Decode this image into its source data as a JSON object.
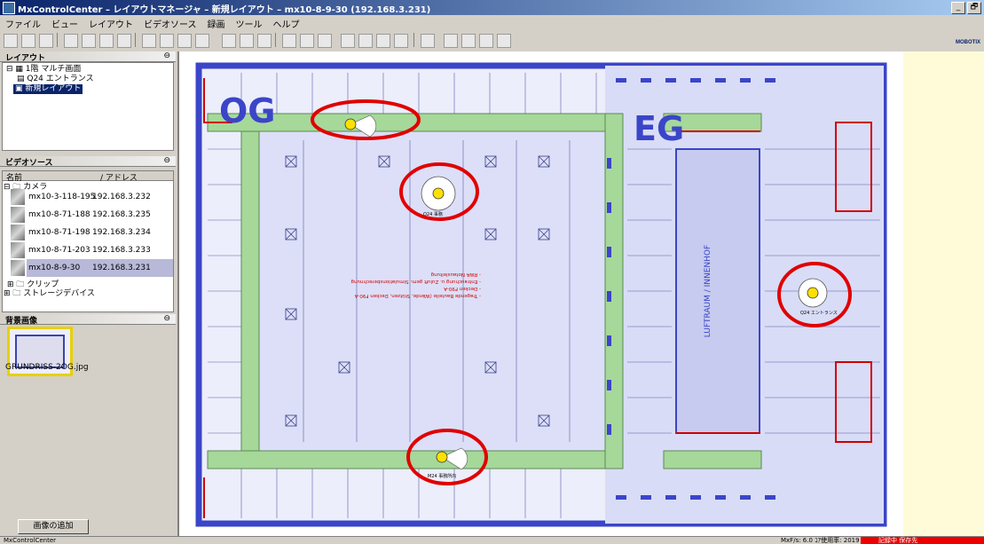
{
  "window": {
    "title": "MxControlCenter – レイアウトマネージャ – 新規レイアウト – mx10-8-9-30 (192.168.3.231)",
    "controls": [
      "_",
      "🗗",
      "×"
    ]
  },
  "menu": [
    "ファイル",
    "ビュー",
    "レイアウト",
    "ビデオソース",
    "録画",
    "ツール",
    "ヘルプ"
  ],
  "brand": "MOBOTIX",
  "layout_pane": {
    "header": "レイアウト",
    "tree": [
      {
        "label": "1階 マルチ画面"
      },
      {
        "label": "Q24 エントランス"
      },
      {
        "label": "新規レイアウト",
        "selected": true
      }
    ]
  },
  "video_source_pane": {
    "header": "ビデオソース",
    "col_name": "名前",
    "col_address": "アドレス",
    "group_camera": "カメラ",
    "cameras": [
      {
        "name": "mx10-3-118-195",
        "address": "192.168.3.232"
      },
      {
        "name": "mx10-8-71-188",
        "address": "192.168.3.235"
      },
      {
        "name": "mx10-8-71-198",
        "address": "192.168.3.234"
      },
      {
        "name": "mx10-8-71-203",
        "address": "192.168.3.233"
      },
      {
        "name": "mx10-8-9-30",
        "address": "192.168.3.231",
        "selected": true
      }
    ],
    "group_clips": "クリップ",
    "group_storage": "ストレージデバイス"
  },
  "background_pane": {
    "header": "背景画像",
    "file": "GRUNDRISS-2OG.jpg",
    "add_button": "画像の追加"
  },
  "floorplan": {
    "label_og": "OG",
    "label_eg": "EG",
    "inner_court": "LUFTRAUM / INNENHOF",
    "note_lines": [
      "- Tragende Bauteile (Wände, Stützen, Decken F90-A",
      "- Decken F90-A",
      "- Entrauchung u. Zuluft gem. Simulationsberechnung",
      "- RWA Notausleitung"
    ],
    "colors": {
      "plan_blue": "#3b45c8",
      "corridor_green": "#a6d89a",
      "highlight_red": "#e00000",
      "camera_yellow": "#ffe000"
    },
    "cameras": [
      {
        "label": "",
        "marker": "camera-top"
      },
      {
        "label": "Q24 事務",
        "marker": "camera-center"
      },
      {
        "label": "Q24 エントランス",
        "marker": "camera-right"
      },
      {
        "label": "M24 事務所内",
        "marker": "camera-bottom"
      }
    ]
  },
  "status": {
    "left": "MxControlCenter",
    "mid": "MxF/s:   6.0   ｺｱ使用率:   2019",
    "alert": "記録中   保存先"
  }
}
